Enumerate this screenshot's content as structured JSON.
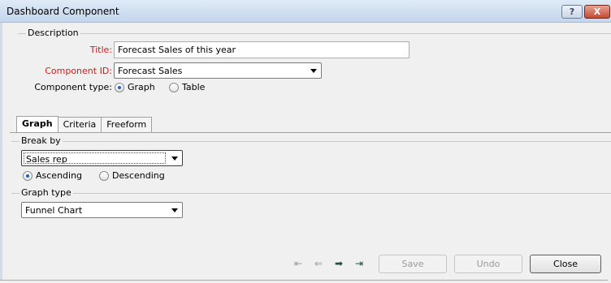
{
  "window": {
    "title": "Dashboard Component",
    "help_label": "?",
    "close_label": "X"
  },
  "description": {
    "group_label": "Description",
    "title_label": "Title:",
    "title_value": "Forecast Sales of this year",
    "component_id_label": "Component ID:",
    "component_id_value": "Forecast Sales",
    "component_type_label": "Component type:",
    "type_graph_label": "Graph",
    "type_table_label": "Table",
    "selected_type": "Graph"
  },
  "tabs": [
    {
      "label": "Graph",
      "active": true
    },
    {
      "label": "Criteria",
      "active": false
    },
    {
      "label": "Freeform",
      "active": false
    }
  ],
  "graph_tab": {
    "break_by_label": "Break by",
    "break_by_value": "Sales rep",
    "ascending_label": "Ascending",
    "descending_label": "Descending",
    "sort_order": "Ascending",
    "graph_type_label": "Graph type",
    "graph_type_value": "Funnel Chart"
  },
  "footer": {
    "nav_icons": [
      "first-record-icon",
      "previous-record-icon",
      "next-record-icon",
      "last-record-icon"
    ],
    "save_label": "Save",
    "undo_label": "Undo",
    "close_label": "Close"
  },
  "colors": {
    "required_label": "#c81e1e",
    "title_bar": "#c4d6ec",
    "radio_selected": "#1c5fbf"
  }
}
